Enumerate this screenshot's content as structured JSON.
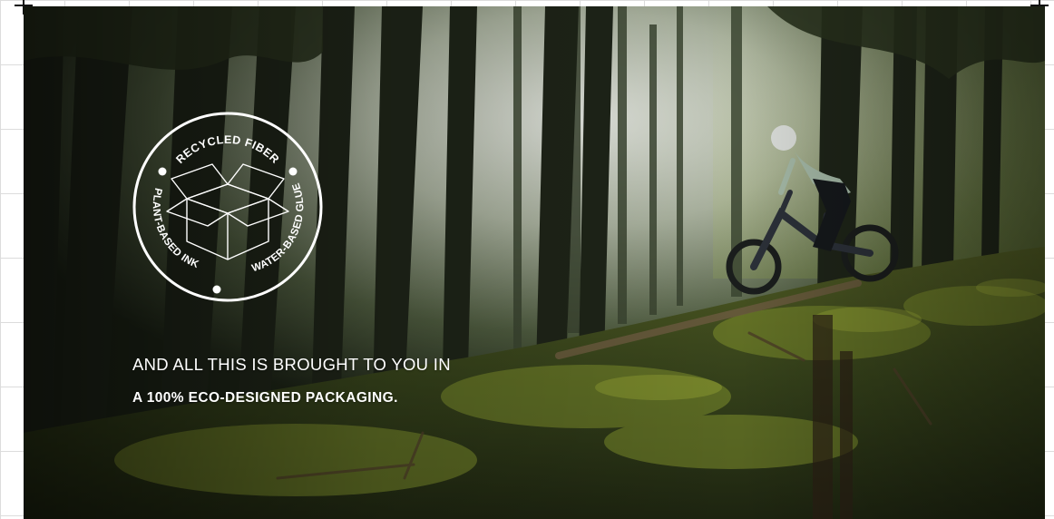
{
  "badge": {
    "top_text": "RECYCLED FIBER",
    "left_text": "PLANT-BASED INK",
    "right_text": "WATER-BASED GLUE",
    "icon": "open-box-icon"
  },
  "headline": {
    "line1": "AND ALL THIS IS BROUGHT TO YOU IN",
    "line2": "A 100% ECO-DESIGNED PACKAGING."
  },
  "colors": {
    "text": "#ffffff",
    "forest_dark": "#1f2616",
    "moss": "#5a6a22",
    "sky_light": "#cfd6d2",
    "grid_line": "#dcdcdc"
  }
}
